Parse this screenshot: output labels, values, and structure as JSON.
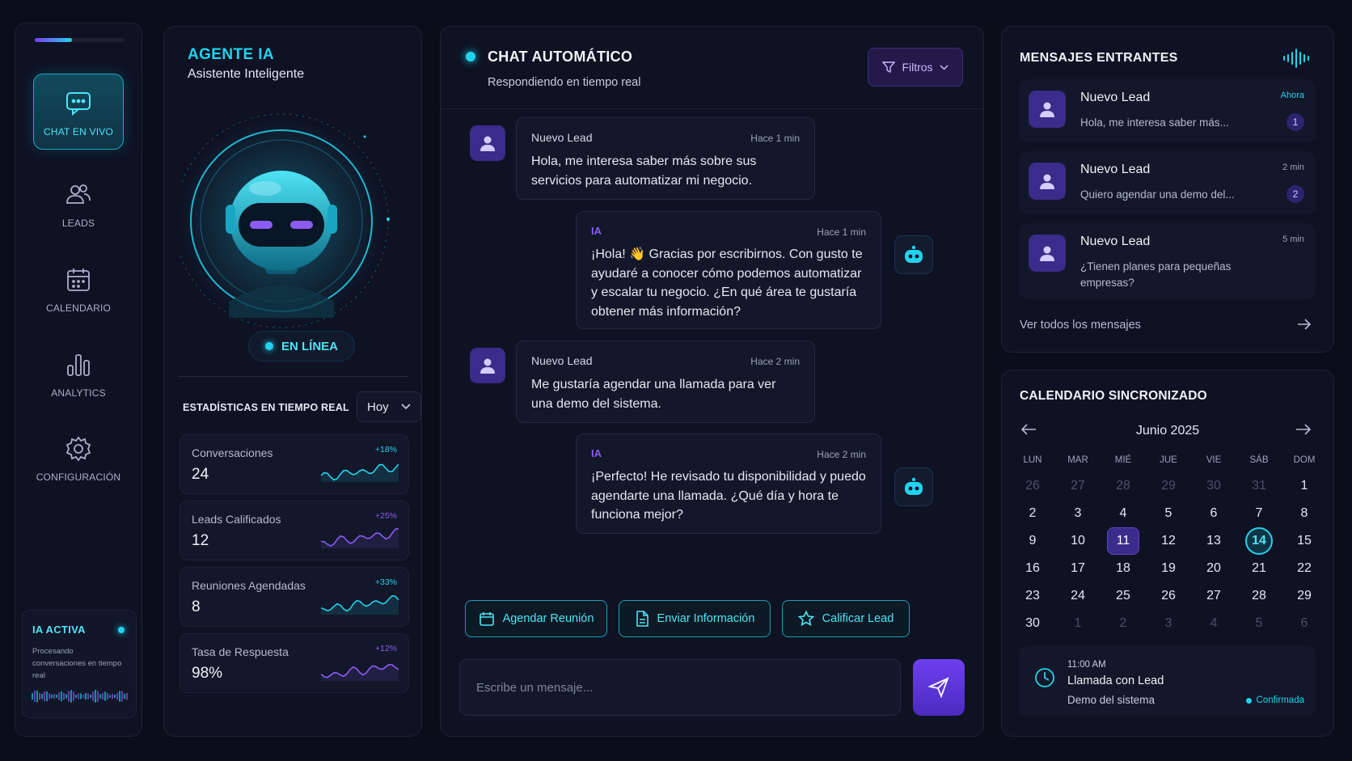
{
  "sidebar": {
    "progress": 0.42,
    "items": [
      {
        "label": "CHAT EN VIVO",
        "icon": "chat-bubble-icon",
        "active": true
      },
      {
        "label": "LEADS",
        "icon": "users-icon"
      },
      {
        "label": "CALENDARIO",
        "icon": "calendar-icon"
      },
      {
        "label": "ANALYTICS",
        "icon": "bar-chart-icon"
      },
      {
        "label": "CONFIGURACIÓN",
        "icon": "gear-icon"
      }
    ],
    "status": {
      "title": "IA ACTIVA",
      "text": "Procesando conversaciones en tiempo real"
    }
  },
  "agent": {
    "title": "AGENTE IA",
    "subtitle": "Asistente Inteligente",
    "status": "EN LÍNEA",
    "stats_title": "ESTADÍSTICAS EN TIEMPO REAL",
    "period": "Hoy",
    "stats": [
      {
        "label": "Conversaciones",
        "value": "24",
        "delta": "+18%",
        "color": "#22d3ee"
      },
      {
        "label": "Leads Calificados",
        "value": "12",
        "delta": "+25%",
        "color": "#8b5cf6"
      },
      {
        "label": "Reuniones Agendadas",
        "value": "8",
        "delta": "+33%",
        "color": "#22d3ee"
      },
      {
        "label": "Tasa de Respuesta",
        "value": "98%",
        "delta": "+12%",
        "color": "#8b5cf6"
      }
    ]
  },
  "chat": {
    "title": "CHAT AUTOMÁTICO",
    "subtitle": "Respondiendo en tiempo real",
    "filter_label": "Filtros",
    "messages": [
      {
        "author": "Nuevo Lead",
        "time": "Hace 1 min",
        "text": "Hola, me interesa saber más sobre sus servicios para automatizar mi negocio."
      },
      {
        "author": "IA",
        "time": "Hace 1 min",
        "text": "¡Hola! 👋 Gracias por escribirnos. Con gusto te ayudaré a conocer cómo podemos automatizar y escalar tu negocio. ¿En qué área te gustaría obtener más información?"
      },
      {
        "author": "Nuevo Lead",
        "time": "Hace 2 min",
        "text": "Me gustaría agendar una llamada para ver una demo del sistema."
      },
      {
        "author": "IA",
        "time": "Hace 2 min",
        "text": "¡Perfecto! He revisado tu disponibilidad y puedo agendarte una llamada. ¿Qué día y hora te funciona mejor?"
      }
    ],
    "actions": [
      "Agendar Reunión",
      "Enviar Información",
      "Calificar Lead"
    ],
    "input_placeholder": "Escribe un mensaje..."
  },
  "inbox": {
    "title": "MENSAJES ENTRANTES",
    "items": [
      {
        "name": "Nuevo Lead",
        "text": "Hola, me interesa saber más...",
        "time": "Ahora",
        "badge": "1"
      },
      {
        "name": "Nuevo Lead",
        "text": "Quiero agendar una demo del...",
        "time": "2 min",
        "badge": "2"
      },
      {
        "name": "Nuevo Lead",
        "text": "¿Tienen planes para pequeñas empresas?",
        "time": "5 min"
      }
    ],
    "see_all": "Ver todos los mensajes"
  },
  "calendar": {
    "title": "CALENDARIO SINCRONIZADO",
    "month": "Junio 2025",
    "weekdays": [
      "LUN",
      "MAR",
      "MIÉ",
      "JUE",
      "VIE",
      "SÁB",
      "DOM"
    ],
    "weeks": [
      [
        "26",
        "27",
        "28",
        "29",
        "30",
        "31",
        "1"
      ],
      [
        "2",
        "3",
        "4",
        "5",
        "6",
        "7",
        "8"
      ],
      [
        "9",
        "10",
        "11",
        "12",
        "13",
        "14",
        "15"
      ],
      [
        "16",
        "17",
        "18",
        "19",
        "20",
        "21",
        "22"
      ],
      [
        "23",
        "24",
        "25",
        "26",
        "27",
        "28",
        "29"
      ],
      [
        "30",
        "1",
        "2",
        "3",
        "4",
        "5",
        "6"
      ]
    ],
    "selected": "11",
    "today": "14",
    "event": {
      "time": "11:00 AM",
      "title": "Llamada con Lead",
      "subtitle": "Demo del sistema",
      "status": "Confirmada"
    }
  }
}
